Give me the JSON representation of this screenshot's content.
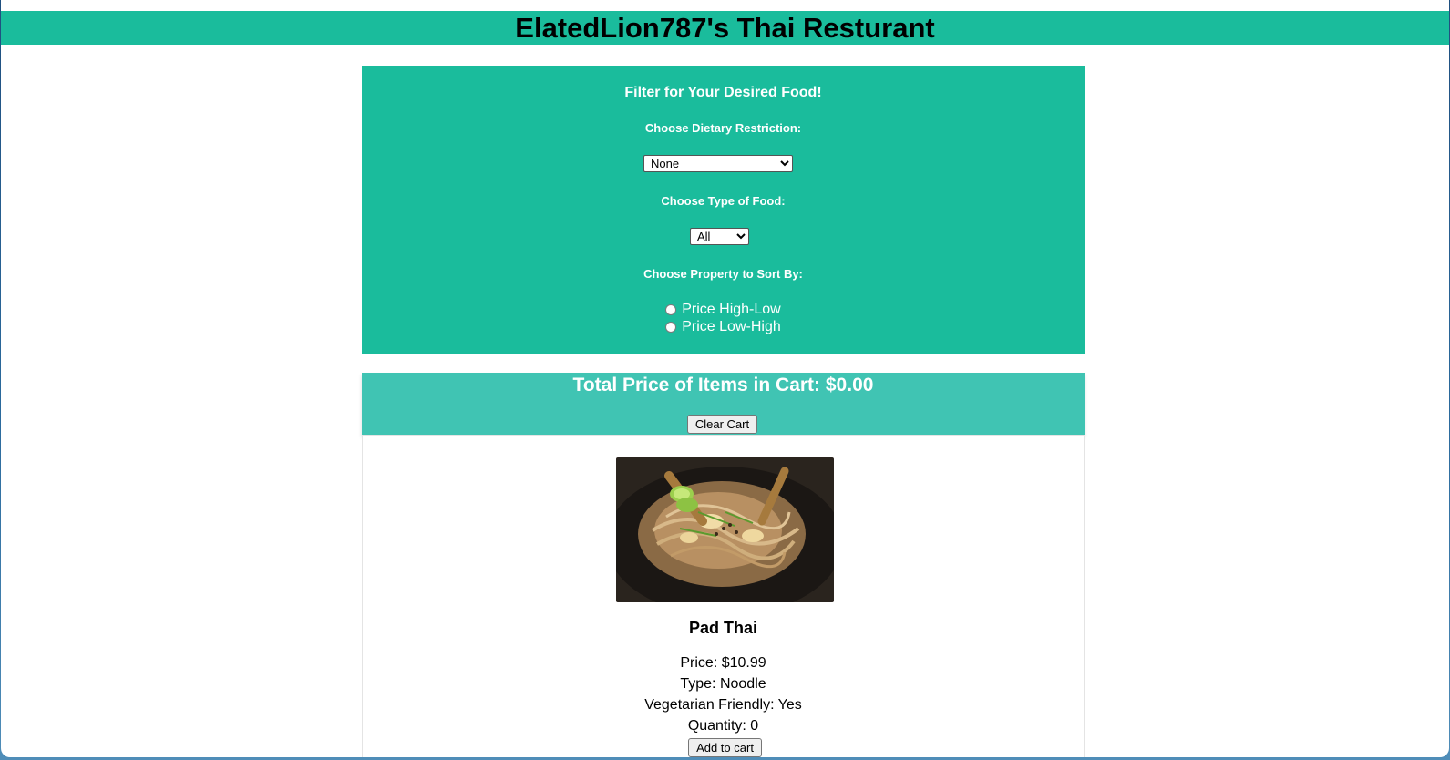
{
  "header": {
    "title": "ElatedLion787's Thai Resturant"
  },
  "filters": {
    "heading": "Filter for Your Desired Food!",
    "dietary_label": "Choose Dietary Restriction:",
    "dietary_selected": "None",
    "type_label": "Choose Type of Food:",
    "type_selected": "All",
    "sort_label": "Choose Property to Sort By:",
    "sort_options": [
      "Price High-Low",
      "Price Low-High"
    ]
  },
  "cart": {
    "total_text": "Total Price of Items in Cart: $0.00",
    "clear_label": "Clear Cart"
  },
  "items": [
    {
      "image_icon": "pad-thai-photo",
      "name": "Pad Thai",
      "price_text": "Price: $10.99",
      "type_text": "Type: Noodle",
      "vegetarian_text": "Vegetarian Friendly: Yes",
      "quantity_text": "Quantity: 0",
      "add_label": "Add to cart"
    }
  ],
  "colors": {
    "header_bg": "#1abc9c",
    "filter_bg": "#1abc9c",
    "cart_bg": "#40c4b3"
  }
}
